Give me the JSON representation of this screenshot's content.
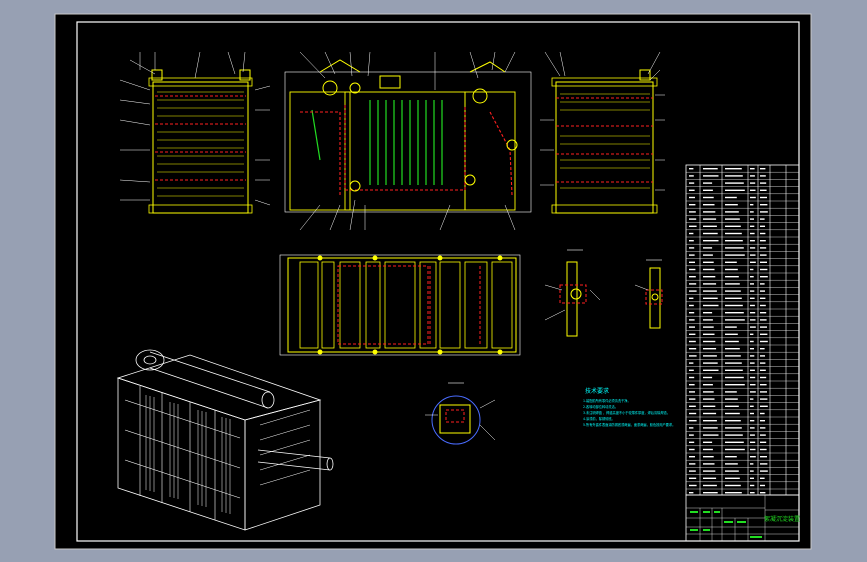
{
  "drawing": {
    "background": "#000000",
    "page_background": "#97A0B3",
    "frame_color": "#FFFFFF"
  },
  "palette": {
    "yellow": "#FFFF00",
    "red": "#FF2020",
    "green": "#22DD22",
    "cyan": "#00FFFF",
    "white": "#FFFFFF",
    "blue": "#4A6CFF"
  },
  "notes": {
    "title": "技术要求",
    "lines": [
      "1.装配前所有零件必须清洗干净。",
      "2.各转动部位转动灵活。",
      "3.未注明焊缝 ，焊缝高度不小于较薄件厚度，焊后清除焊渣。",
      "4.涂漆前，除锈彻底。",
      "5.所有外露件表面涂防锈底漆两遍，面漆两遍，颜色按用户要求。"
    ]
  },
  "title_block": {
    "drawing_name": "絮凝沉淀装置"
  },
  "icons": [
    "isometric-machine-icon"
  ]
}
